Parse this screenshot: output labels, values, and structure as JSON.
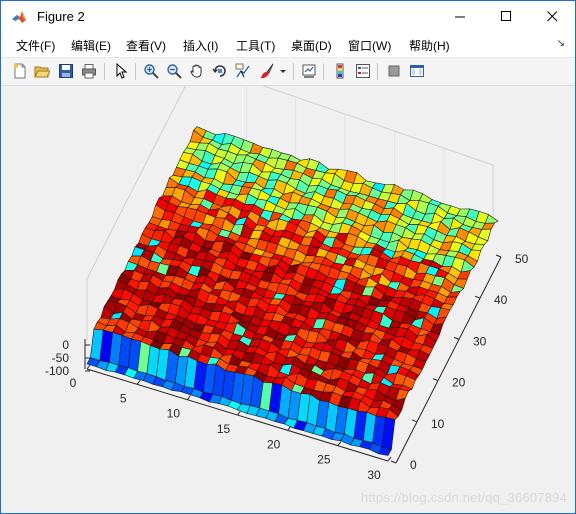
{
  "window": {
    "title": "Figure 2"
  },
  "menu": [
    {
      "label": "文件(F)"
    },
    {
      "label": "编辑(E)"
    },
    {
      "label": "查看(V)"
    },
    {
      "label": "插入(I)"
    },
    {
      "label": "工具(T)"
    },
    {
      "label": "桌面(D)"
    },
    {
      "label": "窗口(W)"
    },
    {
      "label": "帮助(H)"
    }
  ],
  "toolbar": [
    {
      "icon": "new-figure-icon"
    },
    {
      "icon": "open-file-icon"
    },
    {
      "icon": "save-icon"
    },
    {
      "icon": "print-icon"
    },
    {
      "icon": "edit-plot-arrow-icon"
    },
    {
      "icon": "zoom-in-icon"
    },
    {
      "icon": "zoom-out-icon"
    },
    {
      "icon": "pan-hand-icon"
    },
    {
      "icon": "rotate-3d-icon"
    },
    {
      "icon": "data-cursor-icon"
    },
    {
      "icon": "brush-icon"
    },
    {
      "icon": "link-plot-icon"
    },
    {
      "icon": "colorbar-icon"
    },
    {
      "icon": "legend-icon"
    },
    {
      "icon": "hide-plot-tools-icon"
    },
    {
      "icon": "show-plot-tools-icon"
    }
  ],
  "chart_data": {
    "type": "surface",
    "x_ticks": [
      "0",
      "5",
      "10",
      "15",
      "20",
      "25",
      "30"
    ],
    "y_ticks": [
      "0",
      "10",
      "20",
      "30",
      "40",
      "50"
    ],
    "z_ticks": [
      "0",
      "-50",
      "-100"
    ],
    "colormap": "jet",
    "x_range": [
      0,
      30
    ],
    "y_range": [
      0,
      50
    ],
    "z_range": [
      -100,
      0
    ]
  },
  "watermark": "https://blog.csdn.net/qq_36607894",
  "colors": {
    "accent": "#1f6fc6",
    "figure_bg": "#f0f0f0"
  }
}
